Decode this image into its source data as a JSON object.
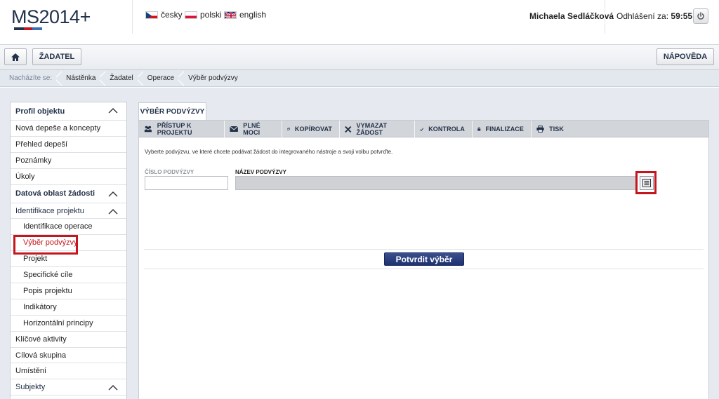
{
  "header": {
    "logo_text": "MS2014+",
    "languages": [
      {
        "label": "česky",
        "flag": "cz-flag-icon"
      },
      {
        "label": "polski",
        "flag": "pl-flag-icon"
      },
      {
        "label": "english",
        "flag": "uk-flag-icon"
      }
    ],
    "user_name": "Michaela Sedláčková",
    "logout_label": "Odhlášení za:",
    "logout_timer": "59:55"
  },
  "toolbar": {
    "home_icon": "home-icon",
    "applicant_label": "ŽADATEL",
    "help_label": "NÁPOVĚDA"
  },
  "breadcrumb": {
    "prefix": "Nacházíte se:",
    "items": [
      "Nástěnka",
      "Žadatel",
      "Operace",
      "Výběr podvýzvy"
    ]
  },
  "sidebar": {
    "items": [
      {
        "label": "Profil objektu"
      },
      {
        "label": "Nová depeše a koncepty"
      },
      {
        "label": "Přehled depeší"
      },
      {
        "label": "Poznámky"
      },
      {
        "label": "Úkoly"
      },
      {
        "label": "Datová oblast žádosti"
      },
      {
        "label": "Identifikace projektu"
      },
      {
        "label": "Identifikace operace"
      },
      {
        "label": "Výběr podvýzvy"
      },
      {
        "label": "Projekt"
      },
      {
        "label": "Specifické cíle"
      },
      {
        "label": "Popis projektu"
      },
      {
        "label": "Indikátory"
      },
      {
        "label": "Horizontální principy"
      },
      {
        "label": "Klíčové aktivity"
      },
      {
        "label": "Cílová skupina"
      },
      {
        "label": "Umístění"
      },
      {
        "label": "Subjekty"
      }
    ]
  },
  "main": {
    "tab_title": "VÝBĚR PODVÝZVY",
    "actions": [
      {
        "label": "PŘÍSTUP K PROJEKTU",
        "icon": "people-icon"
      },
      {
        "label": "PLNÉ MOCI",
        "icon": "envelope-icon"
      },
      {
        "label": "KOPÍROVAT",
        "icon": "copy-icon"
      },
      {
        "label": "VYMAZAT ŽÁDOST",
        "icon": "x-icon"
      },
      {
        "label": "KONTROLA",
        "icon": "check-icon"
      },
      {
        "label": "FINALIZACE",
        "icon": "lock-icon"
      },
      {
        "label": "TISK",
        "icon": "printer-icon"
      }
    ],
    "instructions": "Vyberte podvýzvu, ve které chcete podávat žádost do integrovaného nástroje a svoji volbu potvrďte.",
    "field_cislo_label": "ČÍSLO PODVÝZVY",
    "field_cislo_value": "",
    "field_nazev_label": "NÁZEV PODVÝZVY",
    "field_nazev_value": "",
    "confirm_label": "Potvrdit výběr"
  },
  "colors": {
    "brand_navy": "#23324a",
    "highlight_red": "#c4161c",
    "confirm_blue": "#24377a"
  }
}
